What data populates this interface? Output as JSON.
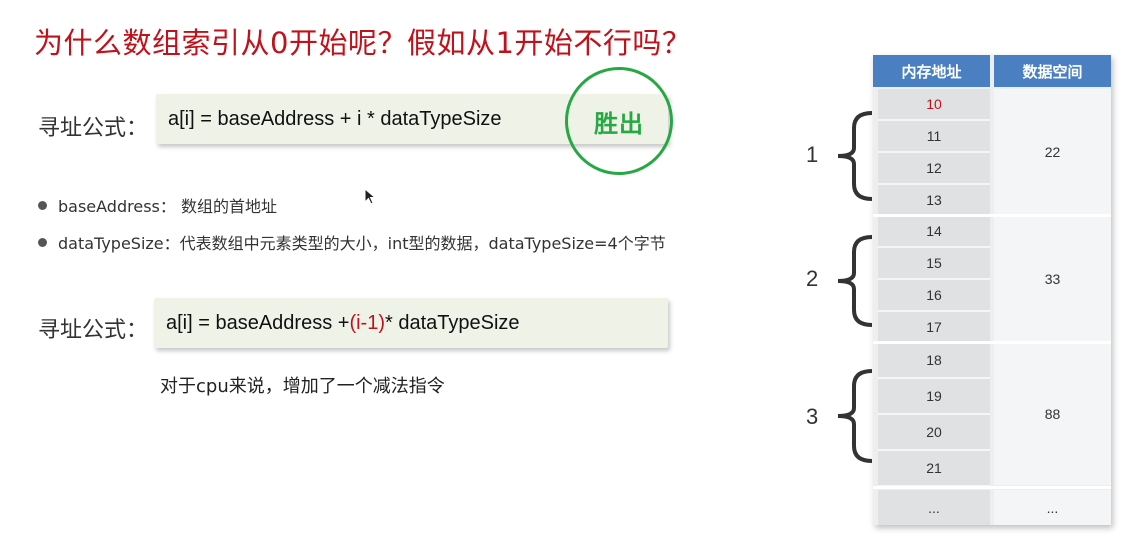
{
  "title": "为什么数组索引从0开始呢？假如从1开始不行吗？",
  "formula1": {
    "label": "寻址公式：",
    "expr": "a[i] = baseAddress + i * dataTypeSize"
  },
  "winner_badge": "胜出",
  "bullets": [
    {
      "text": "baseAddress：  数组的首地址"
    },
    {
      "text": "dataTypeSize：代表数组中元素类型的大小，int型的数据，dataTypeSize=4个字节"
    }
  ],
  "formula2": {
    "label": "寻址公式：",
    "expr_prefix": "a[i] = baseAddress + ",
    "expr_highlight": "(i-1)",
    "expr_suffix": "* dataTypeSize"
  },
  "note": "对于cpu来说，增加了一个减法指令",
  "memory_table": {
    "headers": {
      "address": "内存地址",
      "data": "数据空间"
    },
    "addresses": [
      "10",
      "11",
      "12",
      "13",
      "14",
      "15",
      "16",
      "17",
      "18",
      "19",
      "20",
      "21",
      "..."
    ],
    "highlight_address": "10",
    "data_values": [
      "22",
      "33",
      "88",
      "..."
    ]
  },
  "groups": [
    {
      "label": "1"
    },
    {
      "label": "2"
    },
    {
      "label": "3"
    }
  ],
  "colors": {
    "title": "#c0121b",
    "badge": "#27a844",
    "header": "#4a7fc2",
    "formula_bg": "#eef2e7"
  }
}
